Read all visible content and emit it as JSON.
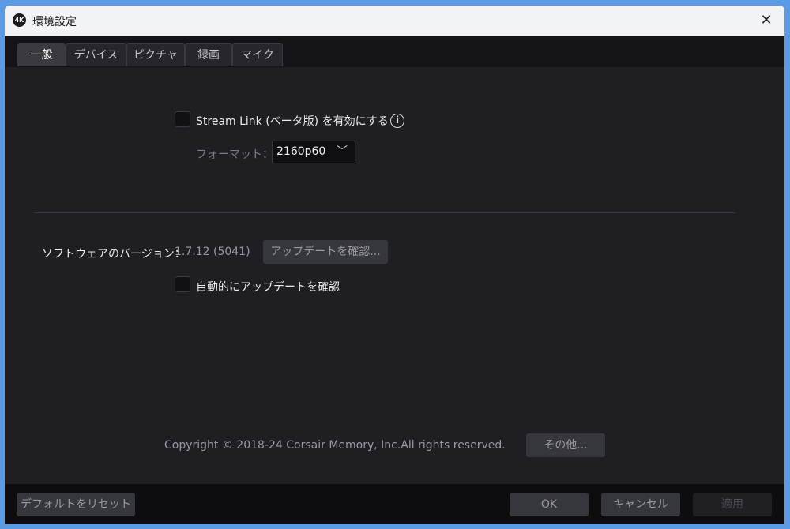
{
  "window": {
    "title": "環境設定",
    "app_icon_text": "4K",
    "close_glyph": "✕"
  },
  "tabs": [
    {
      "label": "一般",
      "active": true
    },
    {
      "label": "デバイス",
      "active": false
    },
    {
      "label": "ピクチャ",
      "active": false
    },
    {
      "label": "録画",
      "active": false
    },
    {
      "label": "マイク",
      "active": false
    }
  ],
  "stream_link": {
    "checkbox_label": "Stream Link (ベータ版) を有効にする",
    "checked": false,
    "info_glyph": "i",
    "format_label": "フォーマット：",
    "format_value": "2160p60",
    "chevron_glyph": "﹀"
  },
  "version": {
    "label": "ソフトウェアのバージョン：",
    "value": "1.7.12 (5041)",
    "check_update_button": "アップデートを確認...",
    "auto_check_label": "自動的にアップデートを確認",
    "auto_check_checked": false
  },
  "copyright": {
    "text": "Copyright © 2018-24 Corsair Memory, Inc.All rights reserved.",
    "more_button": "その他..."
  },
  "footer": {
    "reset_button": "デフォルトをリセット",
    "ok_button": "OK",
    "cancel_button": "キャンセル",
    "apply_button": "適用"
  },
  "colors": {
    "window_bg": "#1e1e23",
    "titlebar_bg": "#f2f3f5",
    "footer_bg": "#0d0d10",
    "button_bg": "#36363d"
  }
}
